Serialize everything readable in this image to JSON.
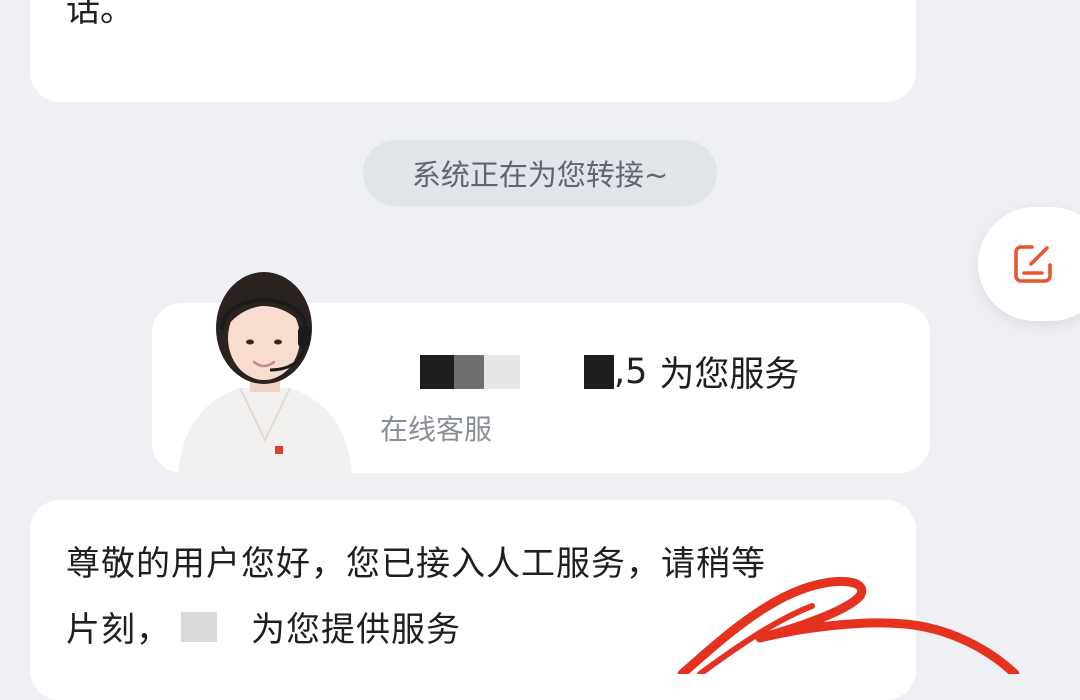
{
  "previous_message": {
    "tail_text": "话。"
  },
  "system_notice": "系统正在为您转接~",
  "side_button": {
    "icon": "edit-icon",
    "color": "#e8552f"
  },
  "agent_card": {
    "id_suffix": "5",
    "serving_text": "为您服务",
    "role": "在线客服",
    "avatar": "customer-service-agent-avatar"
  },
  "agent_message": {
    "line1": "尊敬的用户您好，您已接入人工服务，请稍等",
    "line2_prefix": "片刻，",
    "line2_suffix": "为您提供服务"
  },
  "annotation_color": "#e53220"
}
